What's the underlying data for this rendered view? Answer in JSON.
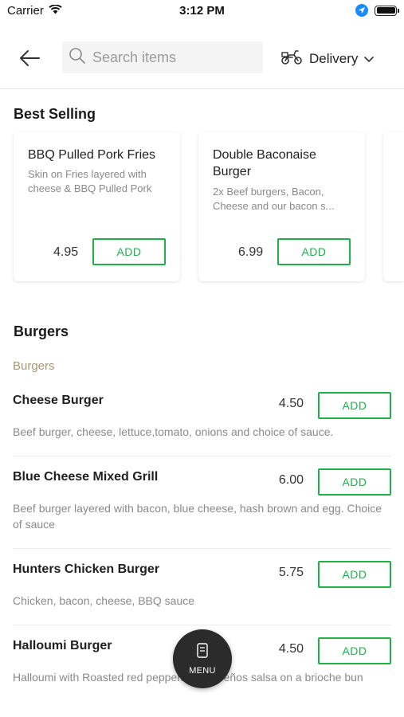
{
  "status_bar": {
    "carrier": "Carrier",
    "time": "3:12 PM"
  },
  "header": {
    "search": {
      "placeholder": "Search items",
      "value": ""
    },
    "delivery_label": "Delivery"
  },
  "best_selling": {
    "title": "Best Selling",
    "items": [
      {
        "name": "BBQ Pulled Pork Fries",
        "description": "Skin on Fries layered with cheese & BBQ Pulled Pork",
        "price": "4.95",
        "add_label": "ADD"
      },
      {
        "name": "Double Baconaise Burger",
        "description": "2x Beef burgers, Bacon, Cheese and our bacon s...",
        "price": "6.99",
        "add_label": "ADD"
      }
    ]
  },
  "burgers": {
    "title": "Burgers",
    "subcategory": "Burgers",
    "items": [
      {
        "name": "Cheese Burger",
        "price": "4.50",
        "description": "Beef burger, cheese, lettuce,tomato, onions and choice of sauce.",
        "add_label": "ADD"
      },
      {
        "name": "Blue Cheese Mixed Grill",
        "price": "6.00",
        "description": "Beef burger layered with bacon, blue cheese, hash brown and egg. Choice of sauce",
        "add_label": "ADD"
      },
      {
        "name": "Hunters Chicken Burger",
        "price": "5.75",
        "description": "Chicken, bacon, cheese, BBQ sauce",
        "add_label": "ADD"
      },
      {
        "name": "Halloumi Burger",
        "price": "4.50",
        "description": "Halloumi with Roasted red peppers & jalapeños salsa on a brioche bun",
        "add_label": "ADD"
      }
    ]
  },
  "menu_button": {
    "label": "MENU"
  },
  "colors": {
    "accent_green": "#20b04b",
    "subcategory": "#a89870",
    "fab": "#2b2b2b"
  }
}
